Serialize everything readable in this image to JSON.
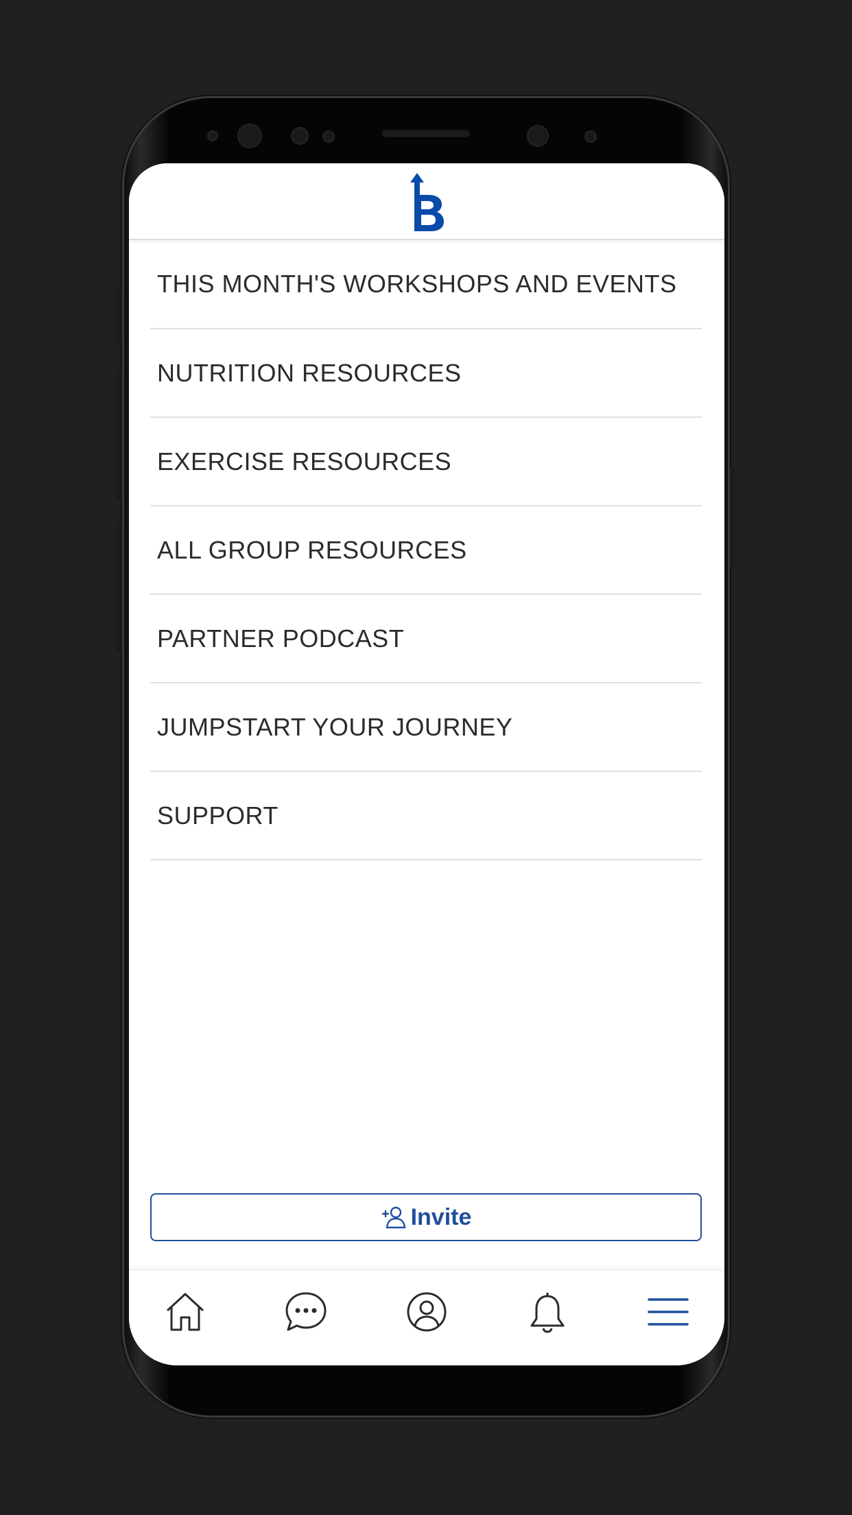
{
  "app": {
    "logo_letter": "B",
    "brand_color": "#0a4aaa",
    "logo_icon": "brand-logo-icon"
  },
  "menu": {
    "items": [
      {
        "label": "THIS MONTH'S WORKSHOPS AND EVENTS"
      },
      {
        "label": "NUTRITION RESOURCES"
      },
      {
        "label": "EXERCISE RESOURCES"
      },
      {
        "label": "ALL GROUP RESOURCES"
      },
      {
        "label": "PARTNER PODCAST"
      },
      {
        "label": "JUMPSTART YOUR JOURNEY"
      },
      {
        "label": "SUPPORT"
      }
    ]
  },
  "invite": {
    "label": "Invite",
    "icon": "add-user-icon"
  },
  "bottom_nav": {
    "items": [
      {
        "icon": "home-icon",
        "active": false
      },
      {
        "icon": "chat-icon",
        "active": false
      },
      {
        "icon": "profile-icon",
        "active": false
      },
      {
        "icon": "bell-icon",
        "active": false
      },
      {
        "icon": "hamburger-menu-icon",
        "active": true
      }
    ],
    "active_color": "#1f4e9c",
    "inactive_color": "#2b2b2b"
  }
}
